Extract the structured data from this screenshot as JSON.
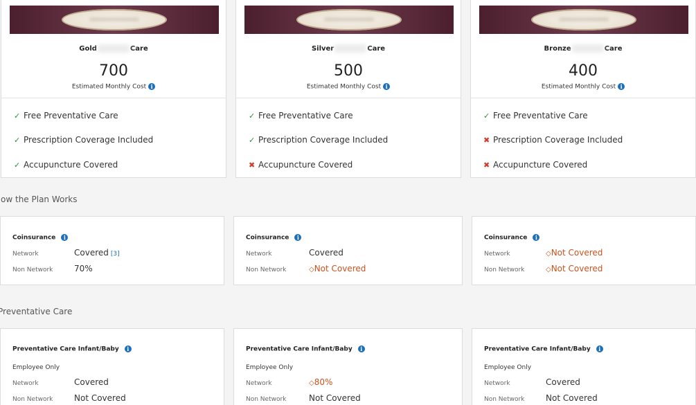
{
  "plans": [
    {
      "name_prefix": "Gold",
      "name_suffix": "Care",
      "price": "700",
      "cost_label": "Estimated Monthly Cost",
      "features": [
        {
          "label": "Free Preventative Care",
          "status": "✓"
        },
        {
          "label": "Prescription Coverage Included",
          "status": "✓"
        },
        {
          "label": "Accupuncture Covered",
          "status": "✓"
        }
      ]
    },
    {
      "name_prefix": "Silver",
      "name_suffix": "Care",
      "price": "500",
      "cost_label": "Estimated Monthly Cost",
      "features": [
        {
          "label": "Free Preventative Care",
          "status": "✓"
        },
        {
          "label": "Prescription Coverage Included",
          "status": "✓"
        },
        {
          "label": "Accupuncture Covered",
          "status": "✖"
        }
      ]
    },
    {
      "name_prefix": "Bronze",
      "name_suffix": "Care",
      "price": "400",
      "cost_label": "Estimated Monthly Cost",
      "features": [
        {
          "label": "Free Preventative Care",
          "status": "✓"
        },
        {
          "label": "Prescription Coverage Included",
          "status": "✖"
        },
        {
          "label": "Accupuncture Covered",
          "status": "✖"
        }
      ]
    }
  ],
  "sections": {
    "how_plan_works": "How the Plan Works",
    "preventative_care": "Preventative Care"
  },
  "coinsurance": [
    {
      "title": "Coinsurance",
      "network_label": "Network",
      "network_value": "Covered",
      "network_ref": "[3]",
      "non_network_label": "Non Network",
      "non_network_value": "70%"
    },
    {
      "title": "Coinsurance",
      "network_label": "Network",
      "network_value": "Covered",
      "non_network_label": "Non Network",
      "non_network_value": "Not Covered"
    },
    {
      "title": "Coinsurance",
      "network_label": "Network",
      "network_value": "Not Covered",
      "non_network_label": "Non Network",
      "non_network_value": "Not Covered"
    }
  ],
  "preventative": [
    {
      "title": "Preventative Care Infant/Baby",
      "group_label": "Employee Only",
      "network_label": "Network",
      "network_value": "Covered",
      "non_network_label": "Non Network",
      "non_network_value": "Not Covered"
    },
    {
      "title": "Preventative Care Infant/Baby",
      "group_label": "Employee Only",
      "network_label": "Network",
      "network_value": "80%",
      "non_network_label": "Non Network",
      "non_network_value": "Not Covered"
    },
    {
      "title": "Preventative Care Infant/Baby",
      "group_label": "Employee Only",
      "network_label": "Network",
      "network_value": "Covered",
      "non_network_label": "Non Network",
      "non_network_value": "Not Covered"
    }
  ],
  "info_glyph": "i",
  "warn_glyph": "◇",
  "colors": {
    "check": "#2e8b3a",
    "cross": "#d23b2a",
    "warning": "#c8521c",
    "info": "#1c6fb8",
    "banner": "#4b1f2e"
  }
}
